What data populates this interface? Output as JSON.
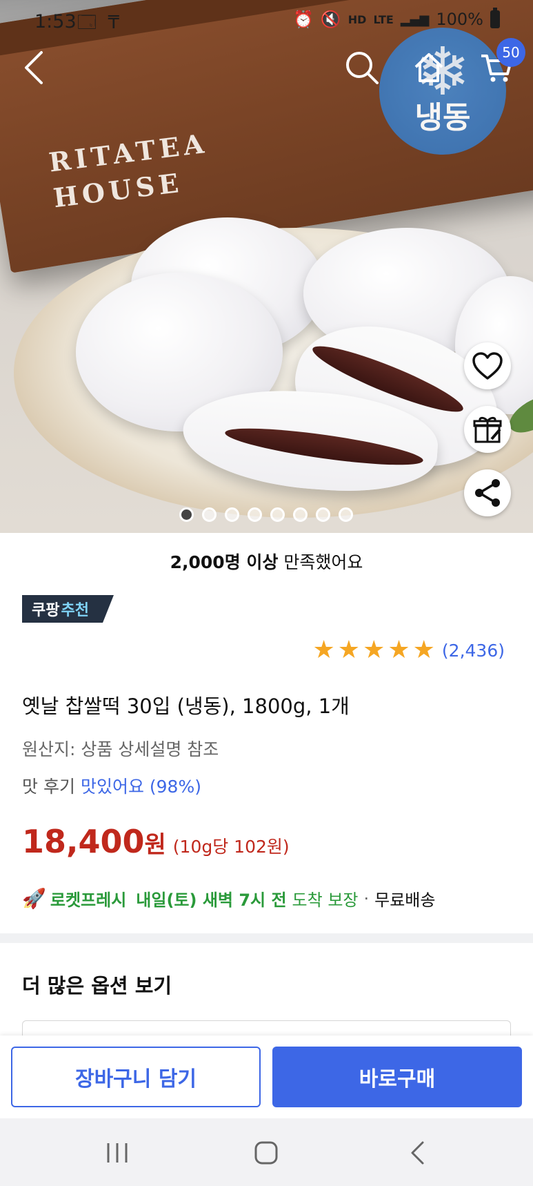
{
  "status_bar": {
    "time": "1:53",
    "left_icons": "🗔 ₸",
    "right_icons": [
      "⏰",
      "🔇",
      "HD",
      "LTE",
      "▂▄▆"
    ],
    "battery": "100%"
  },
  "header": {
    "cart_count": "50",
    "frozen_label": "냉동",
    "frozen_icon": "❄"
  },
  "hero": {
    "brand_text": "RITATEA\nHOUSE",
    "image_count": 8,
    "active_index": 0
  },
  "product": {
    "satisfied_bold": "2,000명 이상",
    "satisfied_rest": " 만족했어요",
    "badge_main": "쿠팡",
    "badge_accent": "추천",
    "stars": 5,
    "review_count": "(2,436)",
    "title": "옛날 찹쌀떡 30입 (냉동), 1800g, 1개",
    "origin": "원산지: 상품 상세설명 참조",
    "taste_label": "맛 후기",
    "taste_value": "맛있어요 (98%)",
    "price_amount": "18,400",
    "price_won": "원",
    "unit_price": "(10g당 102원)",
    "delivery_brand": "로켓프레시",
    "delivery_when": "내일(토) 새벽 7시 전",
    "delivery_guarantee": "도착 보장",
    "delivery_sep": "·",
    "delivery_free": "무료배송"
  },
  "options": {
    "heading": "더 많은 옵션 보기"
  },
  "actions": {
    "cart_label": "장바구니 담기",
    "buy_label": "바로구매"
  },
  "colors": {
    "accent": "#3d67e6",
    "price": "#c0281c",
    "rocket_green": "#2a9a3a",
    "star": "#f5a623"
  }
}
